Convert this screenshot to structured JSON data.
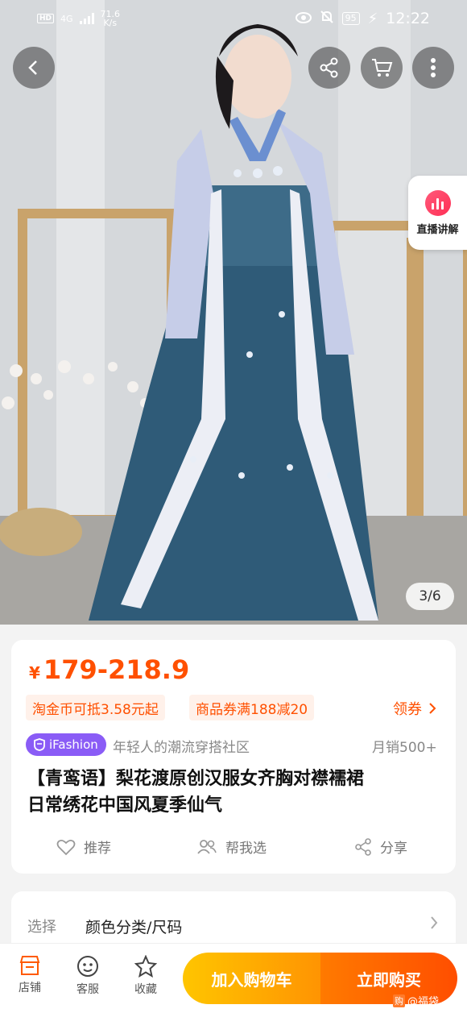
{
  "status_bar": {
    "hd": "HD",
    "net": "4G",
    "speed_value": "71.6",
    "speed_unit": "K/s",
    "battery": "95",
    "time": "12:22"
  },
  "hero": {
    "page_indicator": "3/6",
    "live_label": "直播讲解"
  },
  "product": {
    "currency": "¥",
    "price": "179-218.9",
    "promo_coins": "淘金币可抵3.58元起",
    "promo_coupon": "商品券满188减20",
    "coupon_link": "领券",
    "badge": "iFashion",
    "slogan": "年轻人的潮流穿搭社区",
    "monthly_sales": "月销500+",
    "title_line1": "【青鸾语】梨花渡原创汉服女齐胸对襟襦裙",
    "title_line2": "日常绣花中国风夏季仙气",
    "actions": {
      "recommend": "推荐",
      "help_choose": "帮我选",
      "share": "分享"
    }
  },
  "selection": {
    "label": "选择",
    "value": "颜色分类/尺码"
  },
  "bottom_bar": {
    "store": "店铺",
    "service": "客服",
    "favorite": "收藏",
    "add_to_cart": "加入购物车",
    "buy_now": "立即购买",
    "watermark": "@福袋"
  },
  "colors": {
    "accent": "#ff5000",
    "cart_button": "#ffb400",
    "buy_button": "#ff5a00",
    "ifashion_badge": "#8a5cf6"
  }
}
